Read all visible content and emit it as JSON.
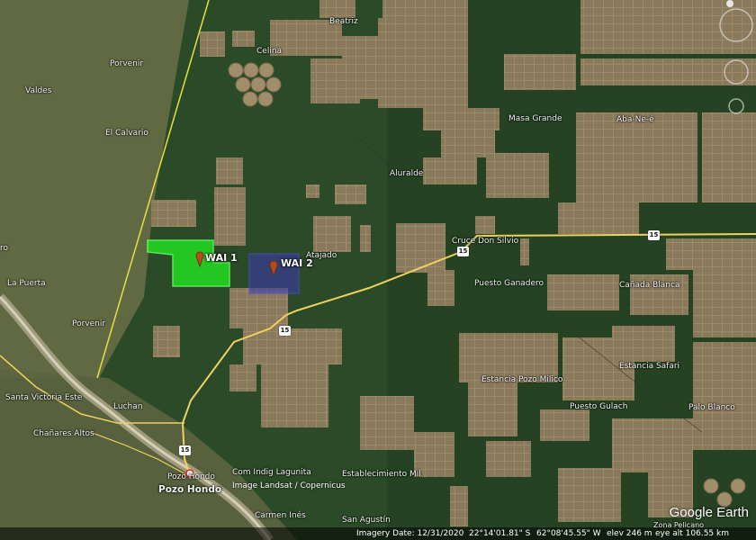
{
  "places": {
    "beatriz": "Beatriz",
    "celina": "Celina",
    "porvenir_n": "Porvenir",
    "valdes": "Valdes",
    "el_calvario": "El Calvario",
    "masa_grande": "Masa Grande",
    "aba_ne_e": "Aba-Ne-é",
    "aluralde": "Aluralde",
    "cruce_don_silvio": "Cruce Don Silvio",
    "atajado": "Atajado",
    "puesto_ganadero": "Puesto Ganadero",
    "canada_blanca": "Cañada Blanca",
    "ro": "ro",
    "la_puerta": "La Puerta",
    "porvenir_s": "Porvenir",
    "santa_victoria_este": "Santa Victoria Este",
    "luchan": "Luchan",
    "chanares_altos": "Chañares Altos",
    "estancia_pozo_milico": "Estancia Pozo Milico",
    "estancia_safari": "Estancia Safari",
    "puesto_gulach": "Puesto Gulach",
    "palo_blanco": "Palo Blanco",
    "pozo_hondo_small": "Pozo Hondo",
    "pozo_hondo": "Pozo Hondo",
    "com_indig_lagunita": "Com Indig Lagunita",
    "establecimiento_mil": "Establecimiento Mil",
    "carmen_ines": "Carmen Inés",
    "san_agustin": "San Agustín",
    "zona_pelicano": "Zona Pelicano"
  },
  "markers": {
    "wai1": "WAI 1",
    "wai2": "WAI 2"
  },
  "route_shields": {
    "r15_a": "15",
    "r15_b": "15",
    "r15_c": "15",
    "r15_d": "15"
  },
  "credits": {
    "imagery": "Image Landsat / Copernicus",
    "logo": "Google Earth"
  },
  "status": {
    "imagery_date": "Imagery Date: 12/31/2020",
    "lat": "22°14'01.81\" S",
    "lon": "62°08'45.55\" W",
    "elev": "elev  246 m",
    "eye_alt": "eye alt 106.55 km"
  },
  "colors": {
    "wai1_fill": "#22dd22",
    "wai2_fill": "#3a3aaa",
    "road": "#f0d060",
    "border": "#e8e040"
  }
}
